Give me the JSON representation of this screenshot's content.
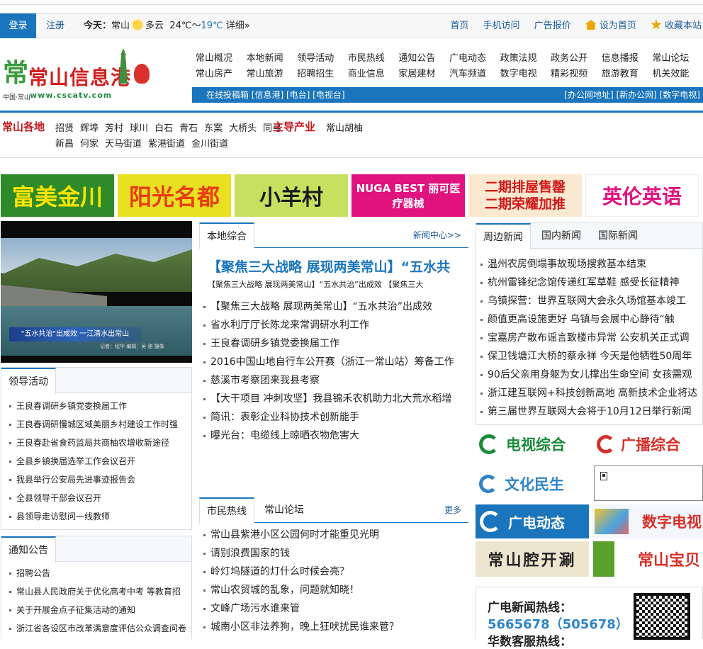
{
  "topbar": {
    "login": "登录",
    "register": "注册",
    "today_label": "今天：",
    "city": "常山",
    "weather": "多云",
    "temp_high": "24℃～",
    "temp_low": "19℃",
    "detail": "详细»",
    "links": [
      "首页",
      "手机访问",
      "广告报价",
      "设为首页",
      "收藏本站"
    ]
  },
  "logo": {
    "name": "常山信息港",
    "glyph": "常",
    "url": "www.cscatv.com",
    "small": "中国·常山"
  },
  "nav": {
    "row1": [
      "常山概况",
      "本地新闻",
      "领导活动",
      "市民热线",
      "通知公告",
      "广电动态",
      "政策法规",
      "政务公开",
      "信息播报",
      "常山论坛"
    ],
    "row2": [
      "常山房产",
      "常山旅游",
      "招聘招生",
      "商业信息",
      "家居建材",
      "汽车频道",
      "数字电视",
      "精彩视频",
      "旅游教育",
      "机关效能"
    ],
    "bar_left": "在线投稿箱 [信息港] [电台] [电视台]",
    "bar_right": "[办公网地址] [新办公网] [数字电视]"
  },
  "regions": {
    "title1": "常山各地",
    "row1": [
      "招贤",
      "辉埠",
      "芳村",
      "球川",
      "白石",
      "青石",
      "东案",
      "大桥头",
      "同弓"
    ],
    "row2": [
      "新昌",
      "何家",
      "天马街道",
      "紫港街道",
      "金川街道"
    ],
    "title2": "主导产业",
    "industry": "常山胡柚"
  },
  "ads": [
    {
      "text": "富美金川",
      "bg": "#2e8b2a",
      "fg": "#ffe400"
    },
    {
      "text": "阳光名都",
      "bg": "#e8e020",
      "fg": "#e83c12"
    },
    {
      "text": "小羊村",
      "bg": "#c8e060",
      "fg": "#1a1a1a"
    },
    {
      "text": "NUGA BEST 丽可医疗器械",
      "bg": "#e0137f",
      "fg": "#ffffff"
    },
    {
      "text": "二期排屋售罄 二期荣耀加推",
      "bg": "#fbe9d2",
      "fg": "#d31a1a"
    },
    {
      "text": "英伦英语",
      "bg": "#ffffff",
      "fg": "#e0137f"
    }
  ],
  "video": {
    "caption": "\"五水共治\"出成效  一江清水出常山",
    "sub": "记者：程华 编辑：吴·骆 摄像"
  },
  "leader": {
    "title": "领导活动",
    "items": [
      "王良春调研乡镇党委换届工作",
      "王良春调研慢城区域美丽乡村建设工作时强",
      "王良春赴省食药监局共商柚农增收新途径",
      "全县乡镇换届选举工作会议召开",
      "我县举行公安局先进事迹报告会",
      "全县领导干部会议召开",
      "县领导走访慰问一线教师"
    ]
  },
  "notice": {
    "title": "通知公告",
    "items": [
      "招聘公告",
      "常山县人民政府关于优化高考中考 等教育招",
      "关于开展金点子征集活动的通知",
      "浙江省各设区市改革满意度评估公众调查问卷"
    ]
  },
  "local": {
    "tab": "本地综合",
    "more": "新闻中心>>",
    "headline": "【聚焦三大战略 展现两美常山】“五水共",
    "subline": "【聚焦三大战略 展现两美常山】“五水共治”出成效   【聚焦三大",
    "items": [
      "【聚焦三大战略 展现两美常山】“五水共治”出成效",
      "省水利厅厅长陈龙来常调研水利工作",
      "王良春调研乡镇党委换届工作",
      "2016中国山地自行车公开赛（浙江一常山站）筹备工作",
      "慈溪市考察团来我县考察",
      "【大干项目 冲刺攻坚】我县锦禾农机助力北大荒水稻增",
      "简讯：表彰企业科协技术创新能手",
      "曝光台：电缆线上晾晒衣物危害大"
    ]
  },
  "hotline": {
    "tabs": [
      "市民热线",
      "常山论坛"
    ],
    "more": "更多",
    "items": [
      "常山县紫港小区公园何时才能重见光明",
      "请别浪费国家的钱",
      "岭灯坞隧道的灯什么时候会亮？",
      "常山农贸城的乱象，问题就知晓！",
      "文峰广场污水谁来管",
      "城南小区非法养狗，晚上狂吠扰民谁来管？"
    ]
  },
  "surround": {
    "tabs": [
      "周边新闻",
      "国内新闻",
      "国际新闻"
    ],
    "items": [
      "温州农房倒塌事故现场搜救基本结束",
      "杭州雷锋纪念馆传递红军草鞋 感受长征精神",
      "乌镇探营：世界互联网大会永久场馆基本竣工",
      "颜值更高设施更好 乌镇与会展中心静待“触",
      "宝嘉房产散布谣言致楼市异常 公安机关正式调",
      "保卫钱塘江大桥的蔡永祥 今天是他牺牲50周年",
      "90后父亲用身躯为女儿撑出生命空间 女孩需观",
      "浙江建互联网+科技创新高地 高新技术企业将达",
      "第三届世界互联网大会将于10月12日举行新闻"
    ]
  },
  "tiles": {
    "tv": "电视综合",
    "radio": "广播综合",
    "culture": "文化民生",
    "news": "广电动态",
    "digital": "数字电视",
    "show": "常山腔开涮",
    "treasure": "常山宝贝"
  },
  "contact": {
    "label": "广电新闻热线：",
    "phone": "5665678（505678）",
    "label2": "华数客服热线："
  },
  "colors": {
    "accent": "#1a75bd",
    "red": "#c4181d"
  }
}
